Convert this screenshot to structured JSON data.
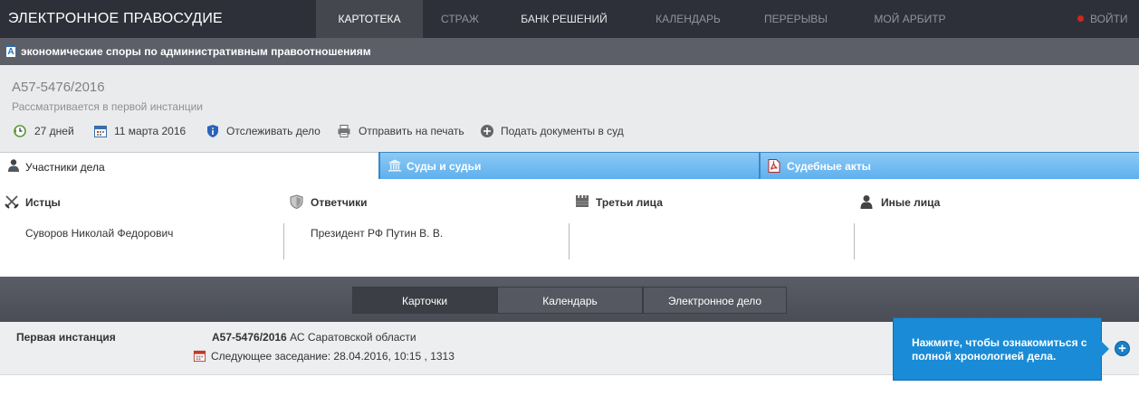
{
  "nav": {
    "brand": "ЭЛЕКТРОННОЕ ПРАВОСУДИЕ",
    "items": [
      {
        "label": "КАРТОТЕКА",
        "active": true
      },
      {
        "label": "СТРАЖ",
        "active": false
      },
      {
        "label": "БАНК РЕШЕНИЙ",
        "active": false
      },
      {
        "label": "КАЛЕНДАРЬ",
        "active": false
      },
      {
        "label": "ПЕРЕРЫВЫ",
        "active": false
      },
      {
        "label": "МОЙ АРБИТР",
        "active": false
      }
    ],
    "login": "ВОЙТИ"
  },
  "category": {
    "icon_letter": "А",
    "label": "экономические споры по административным правоотношениям"
  },
  "case": {
    "number": "А57-5476/2016",
    "status": "Рассматривается в первой инстанции",
    "actions": {
      "days": "27 дней",
      "date": "11 марта 2016",
      "track": "Отслеживать дело",
      "print": "Отправить на печать",
      "submit": "Подать документы в суд"
    }
  },
  "tabs": {
    "participants": "Участники дела",
    "courts": "Суды и судьи",
    "acts": "Судебные акты"
  },
  "participants": {
    "plaintiffs": {
      "title": "Истцы",
      "names": [
        "Суворов Николай Федорович"
      ]
    },
    "defendants": {
      "title": "Ответчики",
      "names": [
        "Президент РФ Путин В. В."
      ]
    },
    "third": {
      "title": "Третьи лица",
      "names": []
    },
    "other": {
      "title": "Иные лица",
      "names": []
    }
  },
  "view_buttons": {
    "cards": "Карточки",
    "calendar": "Календарь",
    "ecase": "Электронное дело"
  },
  "instance": {
    "label": "Первая инстанция",
    "case_number": "А57-5476/2016",
    "court": "АС Саратовской области",
    "next_session": "Следующее заседание: 28.04.2016, 10:15 , 1313"
  },
  "tooltip": {
    "text": "Нажмите, чтобы ознакомиться с полной хронологией дела."
  },
  "colors": {
    "nav_bg": "#2e3039",
    "accent_blue": "#5eb0ef",
    "tooltip_blue": "#1a8bd6",
    "login_dot": "#d0261d"
  }
}
